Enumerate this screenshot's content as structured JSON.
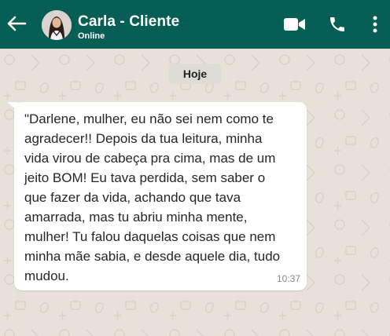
{
  "header": {
    "contact_name": "Carla - Cliente",
    "status": "Online",
    "background_color": "#075e54",
    "icons": {
      "back": "arrow-left-icon",
      "video": "video-call-icon",
      "phone": "phone-call-icon",
      "menu": "more-vertical-icon"
    }
  },
  "chat": {
    "background_color": "#e7e1d8",
    "date_label": "Hoje",
    "messages": [
      {
        "direction": "incoming",
        "text": "\"Darlene, mulher, eu não sei nem como te\nagradecer!! Depois da tua leitura, minha\nvida virou de cabeça pra cima, mas de um\njeito BOM! Eu tava perdida, sem saber o\nque fazer da vida, achando que tava\namarrada, mas tu abriu minha mente,\nmulher! Tu falou daquelas coisas que nem\nminha mãe sabia, e desde aquele dia, tudo\nmudou.",
        "time": "10:37"
      }
    ]
  }
}
